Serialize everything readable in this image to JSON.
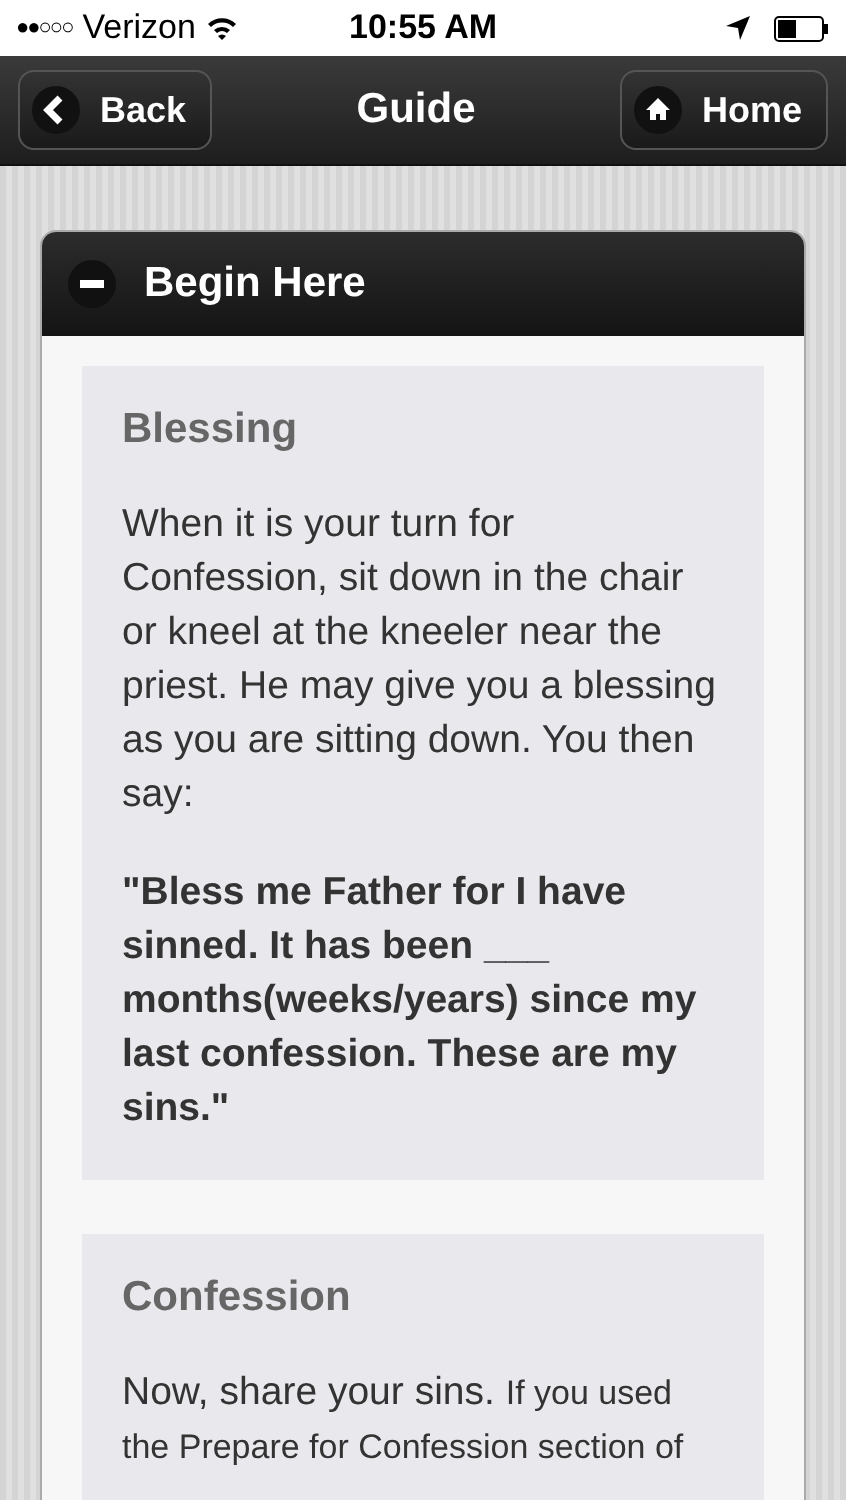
{
  "status_bar": {
    "signal_bars": "●●○○○",
    "carrier": "Verizon",
    "time": "10:55 AM"
  },
  "nav_bar": {
    "back": "Back",
    "title": "Guide",
    "home": "Home"
  },
  "section": {
    "title": "Begin Here",
    "expanded": true,
    "cards": [
      {
        "heading": "Blessing",
        "paragraphs": [
          {
            "kind": "plain",
            "text": "When it is your turn for Confession, sit down in the chair or kneel at the kneeler near the priest. He may give you a blessing as you are sitting down. You then say:"
          },
          {
            "kind": "quote",
            "text": "\"Bless me Father for I have sinned. It has been ___ months(weeks/years) since my last confession. These are my sins.\""
          }
        ]
      },
      {
        "heading": "Confession",
        "paragraphs": [
          {
            "kind": "lead",
            "lead": "Now, share your sins.",
            "text": "If you used the Prepare for Confession section of"
          }
        ]
      }
    ]
  }
}
